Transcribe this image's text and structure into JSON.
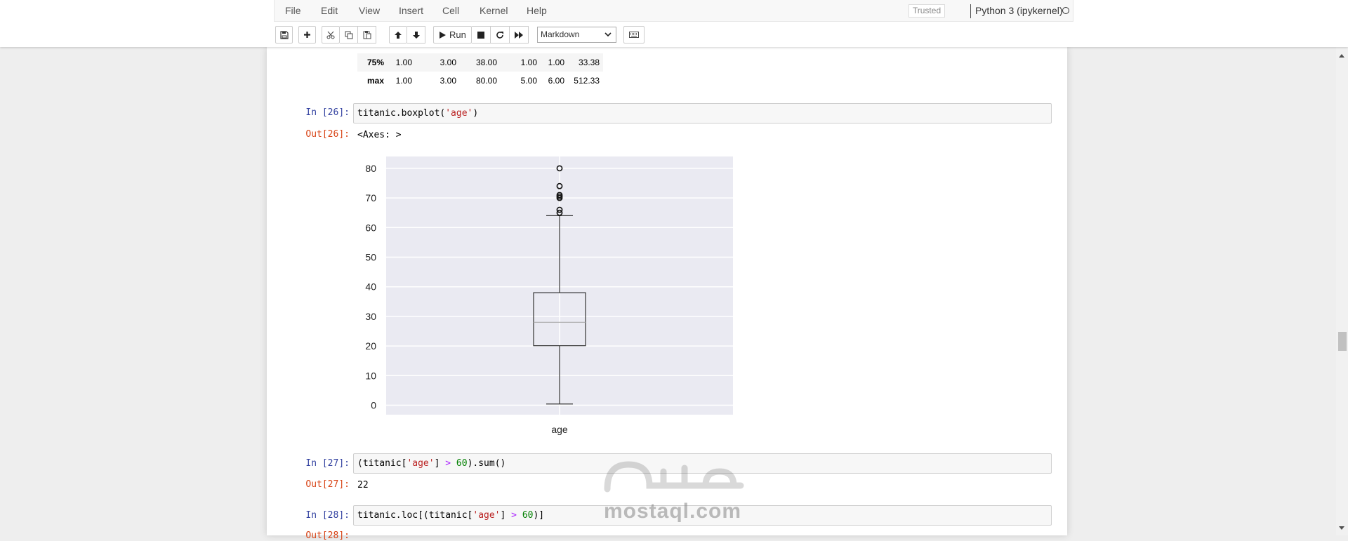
{
  "menu": {
    "items": [
      "File",
      "Edit",
      "View",
      "Insert",
      "Cell",
      "Kernel",
      "Help"
    ],
    "trusted": "Trusted",
    "kernel_name": "Python 3 (ipykernel)"
  },
  "toolbar": {
    "run_label": "Run",
    "cell_type": "Markdown",
    "icons": [
      "save-icon",
      "plus-icon",
      "cut-icon",
      "copy-icon",
      "paste-icon",
      "arrow-up-icon",
      "arrow-down-icon",
      "play-icon",
      "stop-icon",
      "restart-icon",
      "fast-forward-icon",
      "keyboard-icon"
    ]
  },
  "describe_table": {
    "rows": [
      {
        "label": "75%",
        "values": [
          "1.00",
          "3.00",
          "38.00",
          "1.00",
          "1.00",
          "33.38"
        ]
      },
      {
        "label": "max",
        "values": [
          "1.00",
          "3.00",
          "80.00",
          "5.00",
          "6.00",
          "512.33"
        ]
      }
    ]
  },
  "cells": {
    "c26": {
      "in_prompt": "In [26]:",
      "code": "titanic.boxplot('age')",
      "out_prompt": "Out[26]:",
      "output": "<Axes: >"
    },
    "c27": {
      "in_prompt": "In [27]:",
      "code": "(titanic['age'] > 60).sum()",
      "out_prompt": "Out[27]:",
      "output": "22"
    },
    "c28": {
      "in_prompt": "In [28]:",
      "code": "titanic.loc[(titanic['age'] > 60)]",
      "out_prompt": "Out[28]:"
    }
  },
  "chart_data": {
    "type": "boxplot",
    "categories": [
      "age"
    ],
    "ylim": [
      -3.2,
      84
    ],
    "yticks": [
      0,
      10,
      20,
      30,
      40,
      50,
      60,
      70,
      80
    ],
    "grid": true,
    "box": {
      "whisker_low": 0.42,
      "q1": 20.1,
      "median": 28,
      "q3": 38,
      "whisker_high": 64
    },
    "outliers": [
      65,
      66,
      70,
      70.5,
      71,
      74,
      80
    ],
    "colors": {
      "background": "#eaeaf2",
      "grid": "#ffffff",
      "box": "#333333",
      "median": "#aaaaaa"
    }
  },
  "watermark": {
    "latin": "mostaql.com"
  }
}
